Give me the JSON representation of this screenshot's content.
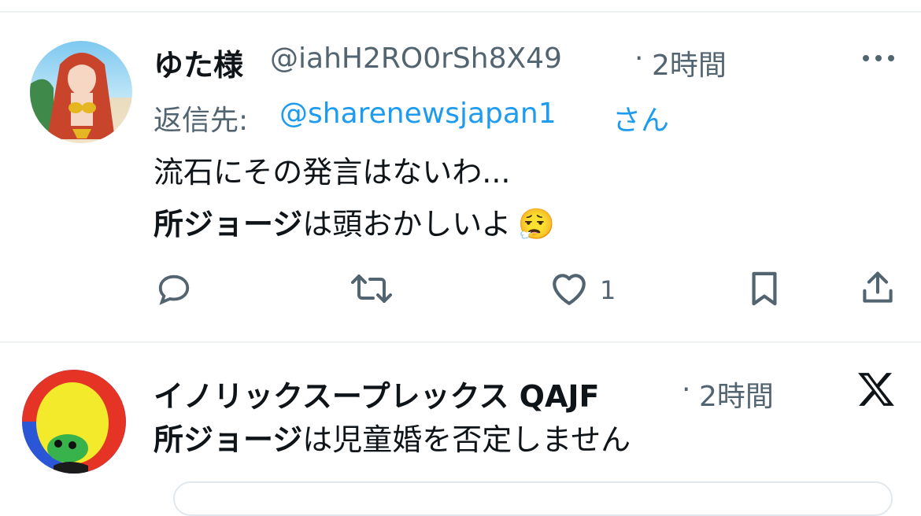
{
  "tweets": [
    {
      "display_name": "ゆた様",
      "handle": "@iahH2RO0rSh8X49",
      "separator": "·",
      "time": "2時間",
      "reply_prefix": "返信先:",
      "reply_to": "@sharenewsjapan1",
      "reply_suffix": "さん",
      "line1": "流石にその発言はないわ...",
      "line2_bold": "所ジョージ",
      "line2_rest": "は頭おかしいよ",
      "emoji": "😮‍💨",
      "like_count": "1",
      "icons": [
        "more-icon",
        "reply-icon",
        "retweet-icon",
        "like-icon",
        "bookmark-icon",
        "share-icon"
      ]
    },
    {
      "display_name": "イノリックスープレックス QAJF",
      "separator": "·",
      "time": "2時間",
      "line1_bold": "所ジョージ",
      "line1_rest": "は児童婚を否定しません",
      "icons": [
        "x-logo-icon"
      ]
    }
  ]
}
